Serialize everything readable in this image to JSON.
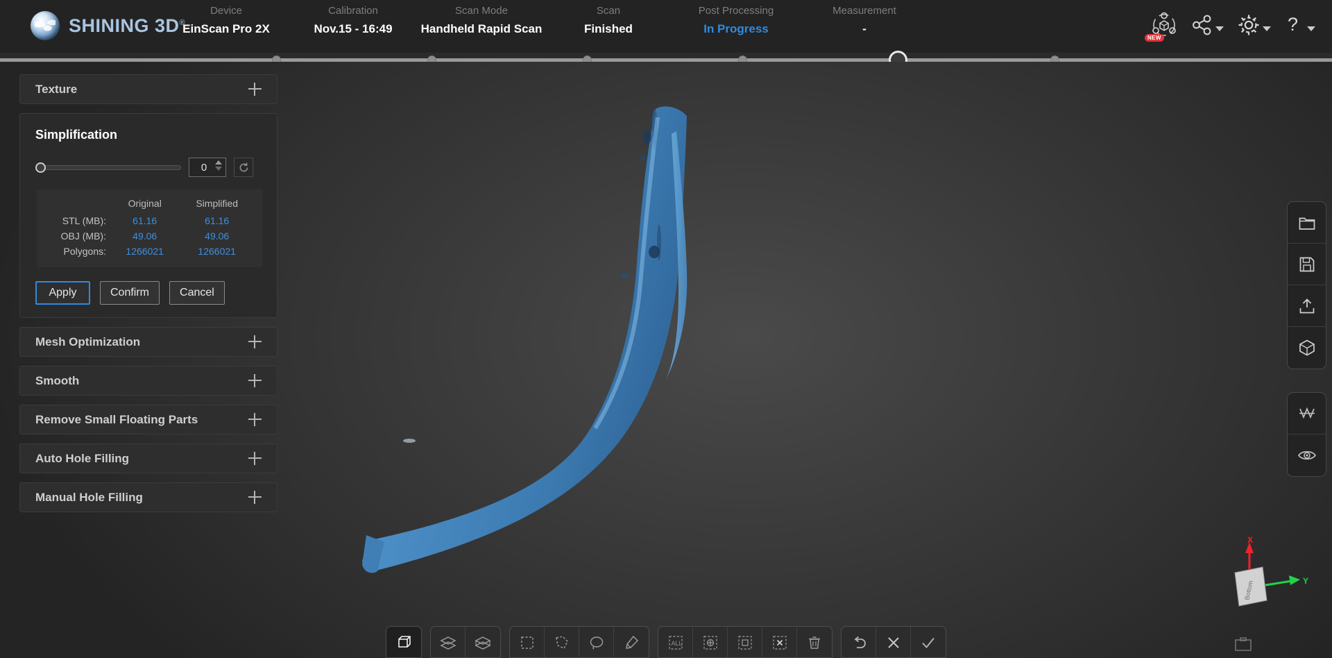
{
  "brand": {
    "name": "SHINING 3D",
    "registered": "®"
  },
  "steps": [
    {
      "label": "Device",
      "value": "EinScan Pro 2X",
      "state": "done"
    },
    {
      "label": "Calibration",
      "value": "Nov.15 - 16:49",
      "state": "done"
    },
    {
      "label": "Scan Mode",
      "value": "Handheld Rapid Scan",
      "state": "done"
    },
    {
      "label": "Scan",
      "value": "Finished",
      "state": "done"
    },
    {
      "label": "Post Processing",
      "value": "In Progress",
      "state": "active"
    },
    {
      "label": "Measurement",
      "value": "-",
      "state": "pending"
    }
  ],
  "top_icons": [
    {
      "name": "model-share-icon",
      "badge": "NEW",
      "caret": false
    },
    {
      "name": "share-icon",
      "badge": "",
      "caret": true
    },
    {
      "name": "gear-icon",
      "badge": "",
      "caret": true
    },
    {
      "name": "help-icon",
      "badge": "",
      "caret": true
    }
  ],
  "left_panel": {
    "texture": {
      "label": "Texture"
    },
    "simplification": {
      "title": "Simplification",
      "slider_value": 0,
      "slider_min": 0,
      "slider_max": 100,
      "spin_value": "0",
      "stats": {
        "col_blank": "",
        "col_original": "Original",
        "col_simplified": "Simplified",
        "rows": [
          {
            "key": "STL (MB):",
            "original": "61.16",
            "simplified": "61.16"
          },
          {
            "key": "OBJ (MB):",
            "original": "49.06",
            "simplified": "49.06"
          },
          {
            "key": "Polygons:",
            "original": "1266021",
            "simplified": "1266021"
          }
        ]
      },
      "buttons": [
        {
          "label": "Apply",
          "focused": true
        },
        {
          "label": "Confirm",
          "focused": false
        },
        {
          "label": "Cancel",
          "focused": false
        }
      ]
    },
    "sections": [
      {
        "label": "Mesh Optimization"
      },
      {
        "label": "Smooth"
      },
      {
        "label": "Remove Small Floating Parts"
      },
      {
        "label": "Auto Hole Filling"
      },
      {
        "label": "Manual Hole Filling"
      }
    ]
  },
  "right_toolbar": {
    "group_a": [
      {
        "name": "folder-open-icon"
      },
      {
        "name": "save-icon"
      },
      {
        "name": "export-icon"
      },
      {
        "name": "model-cube-icon"
      }
    ],
    "group_b": [
      {
        "name": "mesh-wireframe-icon"
      },
      {
        "name": "eye-visibility-icon"
      }
    ]
  },
  "bottom_toolbar": {
    "group1": [
      {
        "name": "bounding-box-icon",
        "selected": true
      }
    ],
    "group2": [
      {
        "name": "layers-front-icon"
      },
      {
        "name": "layers-through-icon"
      }
    ],
    "group3": [
      {
        "name": "rect-select-icon"
      },
      {
        "name": "polygon-select-icon"
      },
      {
        "name": "lasso-select-icon"
      },
      {
        "name": "brush-select-icon"
      }
    ],
    "group4": [
      {
        "name": "select-all-icon"
      },
      {
        "name": "invert-select-icon"
      },
      {
        "name": "unselect-icon"
      },
      {
        "name": "deselect-icon"
      },
      {
        "name": "delete-icon"
      }
    ],
    "group5": [
      {
        "name": "undo-icon"
      },
      {
        "name": "cancel-icon"
      },
      {
        "name": "confirm-icon"
      }
    ]
  },
  "gizmo": {
    "x_label": "X",
    "y_label": "Y",
    "face_label": "Bottom",
    "x_color": "#f0222c",
    "y_color": "#22d24a"
  },
  "colors": {
    "accent_blue": "#2f8ae0",
    "stat_blue": "#3f8fe0",
    "model_blue": "#4a8fc4",
    "panel_bg": "#2a2a2a",
    "topbar_bg": "#232323"
  }
}
